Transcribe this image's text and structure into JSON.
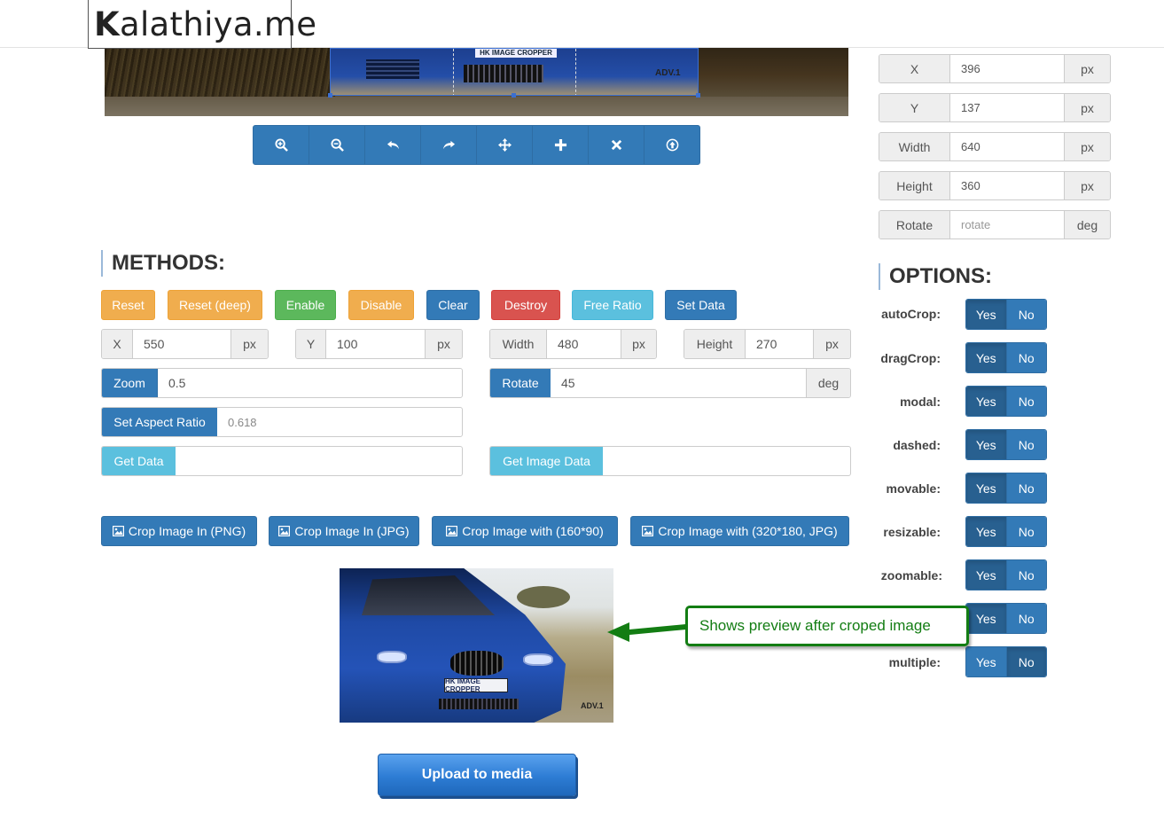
{
  "brand": {
    "bold": "K",
    "rest": "alathiya.me"
  },
  "cropper": {
    "plate": "HK IMAGE CROPPER",
    "logo": "ADV.1"
  },
  "toolbar": {
    "buttons": [
      {
        "icon": "zoom-in-icon"
      },
      {
        "icon": "zoom-out-icon"
      },
      {
        "icon": "rotate-left-icon"
      },
      {
        "icon": "rotate-right-icon"
      },
      {
        "icon": "move-icon"
      },
      {
        "icon": "plus-icon"
      },
      {
        "icon": "close-icon"
      },
      {
        "icon": "upload-icon"
      }
    ]
  },
  "data_panel": {
    "rows": [
      {
        "label": "X",
        "value": "396",
        "unit": "px"
      },
      {
        "label": "Y",
        "value": "137",
        "unit": "px"
      },
      {
        "label": "Width",
        "value": "640",
        "unit": "px"
      },
      {
        "label": "Height",
        "value": "360",
        "unit": "px"
      },
      {
        "label": "Rotate",
        "placeholder": "rotate",
        "unit": "deg"
      }
    ]
  },
  "methods": {
    "heading": "METHODS:",
    "buttons": [
      "Reset",
      "Reset (deep)",
      "Enable",
      "Disable",
      "Clear",
      "Destroy",
      "Free Ratio",
      "Set Data"
    ],
    "x": {
      "label": "X",
      "value": "550",
      "unit": "px"
    },
    "y": {
      "label": "Y",
      "value": "100",
      "unit": "px"
    },
    "width": {
      "label": "Width",
      "value": "480",
      "unit": "px"
    },
    "height": {
      "label": "Height",
      "value": "270",
      "unit": "px"
    },
    "zoom": {
      "label": "Zoom",
      "value": "0.5"
    },
    "rotate": {
      "label": "Rotate",
      "value": "45",
      "unit": "deg"
    },
    "aspect": {
      "label": "Set Aspect Ratio",
      "placeholder": "0.618"
    },
    "get_data": {
      "label": "Get Data",
      "value": ""
    },
    "get_image_data": {
      "label": "Get Image Data",
      "value": ""
    },
    "crop_buttons": [
      "Crop Image In (PNG)",
      "Crop Image In (JPG)",
      "Crop Image with (160*90)",
      "Crop Image with (320*180, JPG)"
    ]
  },
  "options": {
    "heading": "OPTIONS:",
    "yes": "Yes",
    "no": "No",
    "items": [
      {
        "label": "autoCrop:",
        "selected": "yes"
      },
      {
        "label": "dragCrop:",
        "selected": "yes"
      },
      {
        "label": "modal:",
        "selected": "yes"
      },
      {
        "label": "dashed:",
        "selected": "yes"
      },
      {
        "label": "movable:",
        "selected": "yes"
      },
      {
        "label": "resizable:",
        "selected": "yes"
      },
      {
        "label": "zoomable:",
        "selected": "yes"
      },
      {
        "label": "",
        "selected": "yes"
      },
      {
        "label": "multiple:",
        "selected": "no"
      }
    ]
  },
  "preview": {
    "plate": "HK IMAGE CROPPER",
    "logo": "ADV.1"
  },
  "annotation": {
    "text": "Shows preview after croped image",
    "color": "#137d13"
  },
  "upload_label": "Upload to media"
}
